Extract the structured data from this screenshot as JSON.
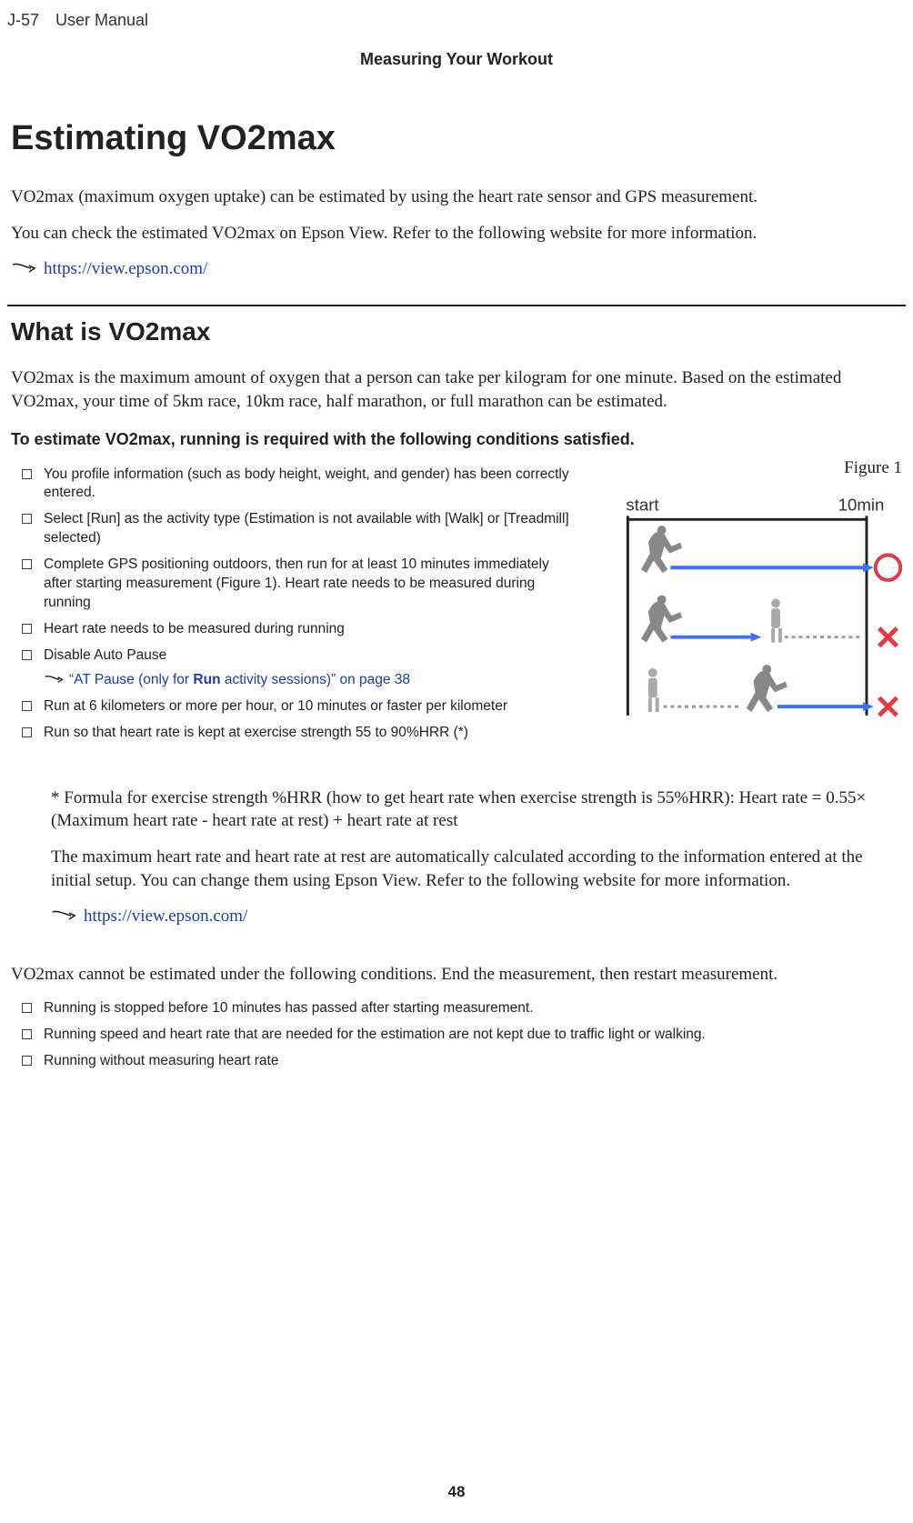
{
  "header": {
    "model": "J-57",
    "manual": "User Manual",
    "section": "Measuring Your Workout"
  },
  "h1": "Estimating VO2max",
  "intro_p1": "VO2max (maximum oxygen uptake) can be estimated by using the heart rate sensor and GPS measurement.",
  "intro_p2": "You can check the estimated VO2max on Epson View. Refer to the following website for more information.",
  "link1": "https://view.epson.com/",
  "h2": "What is VO2max",
  "what_p1": "VO2max is the maximum amount of oxygen that a person can take per kilogram for one minute. Based on the estimated VO2max, your time of 5km race, 10km race, half marathon, or full marathon can be estimated.",
  "conditions_title": "To estimate VO2max, running is required with the following conditions satisfied.",
  "figure_label": "Figure 1",
  "figure_start": "start",
  "figure_time": "10min",
  "conditions": [
    "You profile information (such as body height, weight, and gender) has been correctly entered.",
    "Select [Run] as the activity type (Estimation is not available with [Walk] or [Treadmill] selected)",
    "Complete GPS positioning outdoors, then run for at least 10 minutes immediately after starting measurement (Figure 1). Heart rate needs to be measured during running",
    "Heart rate needs to be measured during running",
    "Disable Auto Pause",
    "Run at 6 kilometers or more per hour, or 10 minutes or faster per kilometer",
    "Run so that heart rate is kept at exercise strength 55 to 90%HRR (*)"
  ],
  "at_pause_link_pre": "“AT Pause (only for ",
  "at_pause_link_run": "Run",
  "at_pause_link_post": " activity sessions)” on page 38",
  "formula_p": "* Formula for exercise strength %HRR (how to get heart rate when exercise strength is 55%HRR): Heart rate = 0.55× (Maximum heart rate - heart rate at rest) + heart rate at rest",
  "maxhr_p": "The maximum heart rate and heart rate at rest are automatically calculated according to the information entered at the initial setup. You can change them using Epson View. Refer to the following website for more information.",
  "link2": "https://view.epson.com/",
  "cannot_p": "VO2max cannot be estimated under the following conditions. End the measurement, then restart measurement.",
  "cannot_list": [
    "Running is stopped before 10 minutes has passed after starting measurement.",
    "Running speed and heart rate that are needed for the estimation are not kept due to traffic light or walking.",
    "Running without measuring heart rate"
  ],
  "page_number": "48"
}
